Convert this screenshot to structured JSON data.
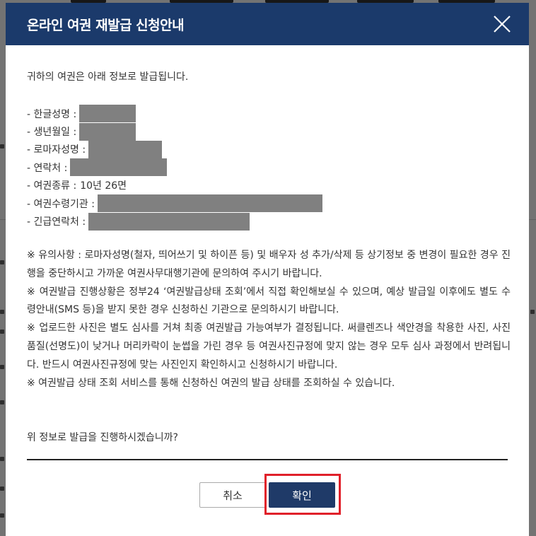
{
  "modal": {
    "title": "온라인 여권 재발급 신청안내",
    "intro": "귀하의 여권은 아래 정보로 발급됩니다.",
    "fields": [
      {
        "label": "- 한글성명 :",
        "value": "",
        "redacted": true
      },
      {
        "label": "- 생년월일 :",
        "value": "",
        "redacted": true
      },
      {
        "label": "- 로마자성명 :",
        "value": "",
        "redacted": true
      },
      {
        "label": "-  연락처 :",
        "value": "",
        "redacted": true
      },
      {
        "label": "- 여권종류 :",
        "value": "10년 26면",
        "redacted": false
      },
      {
        "label": "- 여권수령기관 :",
        "value": "",
        "redacted": true
      },
      {
        "label": "- 긴급연락처 :",
        "value": "",
        "redacted": true
      }
    ],
    "notices": [
      "※ 유의사항 : 로마자성명(철자, 띄어쓰기 및 하이픈 등) 및 배우자 성 추가/삭제 등 상기정보 중 변경이 필요한 경우 진행을 중단하시고 가까운 여권사무대행기관에 문의하여 주시기 바랍니다.",
      "※ 여권발급 진행상황은 정부24 ‘여권발급상태 조회’에서 직접 확인해보실 수 있으며, 예상 발급일 이후에도 별도 수령안내(SMS 등)을 받지 못한 경우 신청하신 기관으로 문의하시기 바랍니다.",
      "※ 업로드한 사진은 별도 심사를 거쳐 최종 여권발급 가능여부가 결정됩니다. 써클렌즈나 색안경을 착용한 사진, 사진품질(선명도)이 낮거나 머리카락이 눈썹을 가린 경우 등 여권사진규정에 맞지 않는 경우 모두 심사 과정에서 반려됩니다. 반드시 여권사진규정에 맞는 사진인지 확인하시고 신청하시기 바랍니다.",
      "※ 여권발급 상태 조회 서비스를 통해 신청하신 여권의 발급 상태를 조회하실 수 있습니다."
    ],
    "question": "위 정보로 발급을 진행하시겠습니까?",
    "cancel_label": "취소",
    "confirm_label": "확인"
  },
  "colors": {
    "header_bg": "#1b3a6b",
    "confirm_bg": "#1f3a68",
    "highlight": "#e0202a",
    "redaction": "#808080"
  }
}
